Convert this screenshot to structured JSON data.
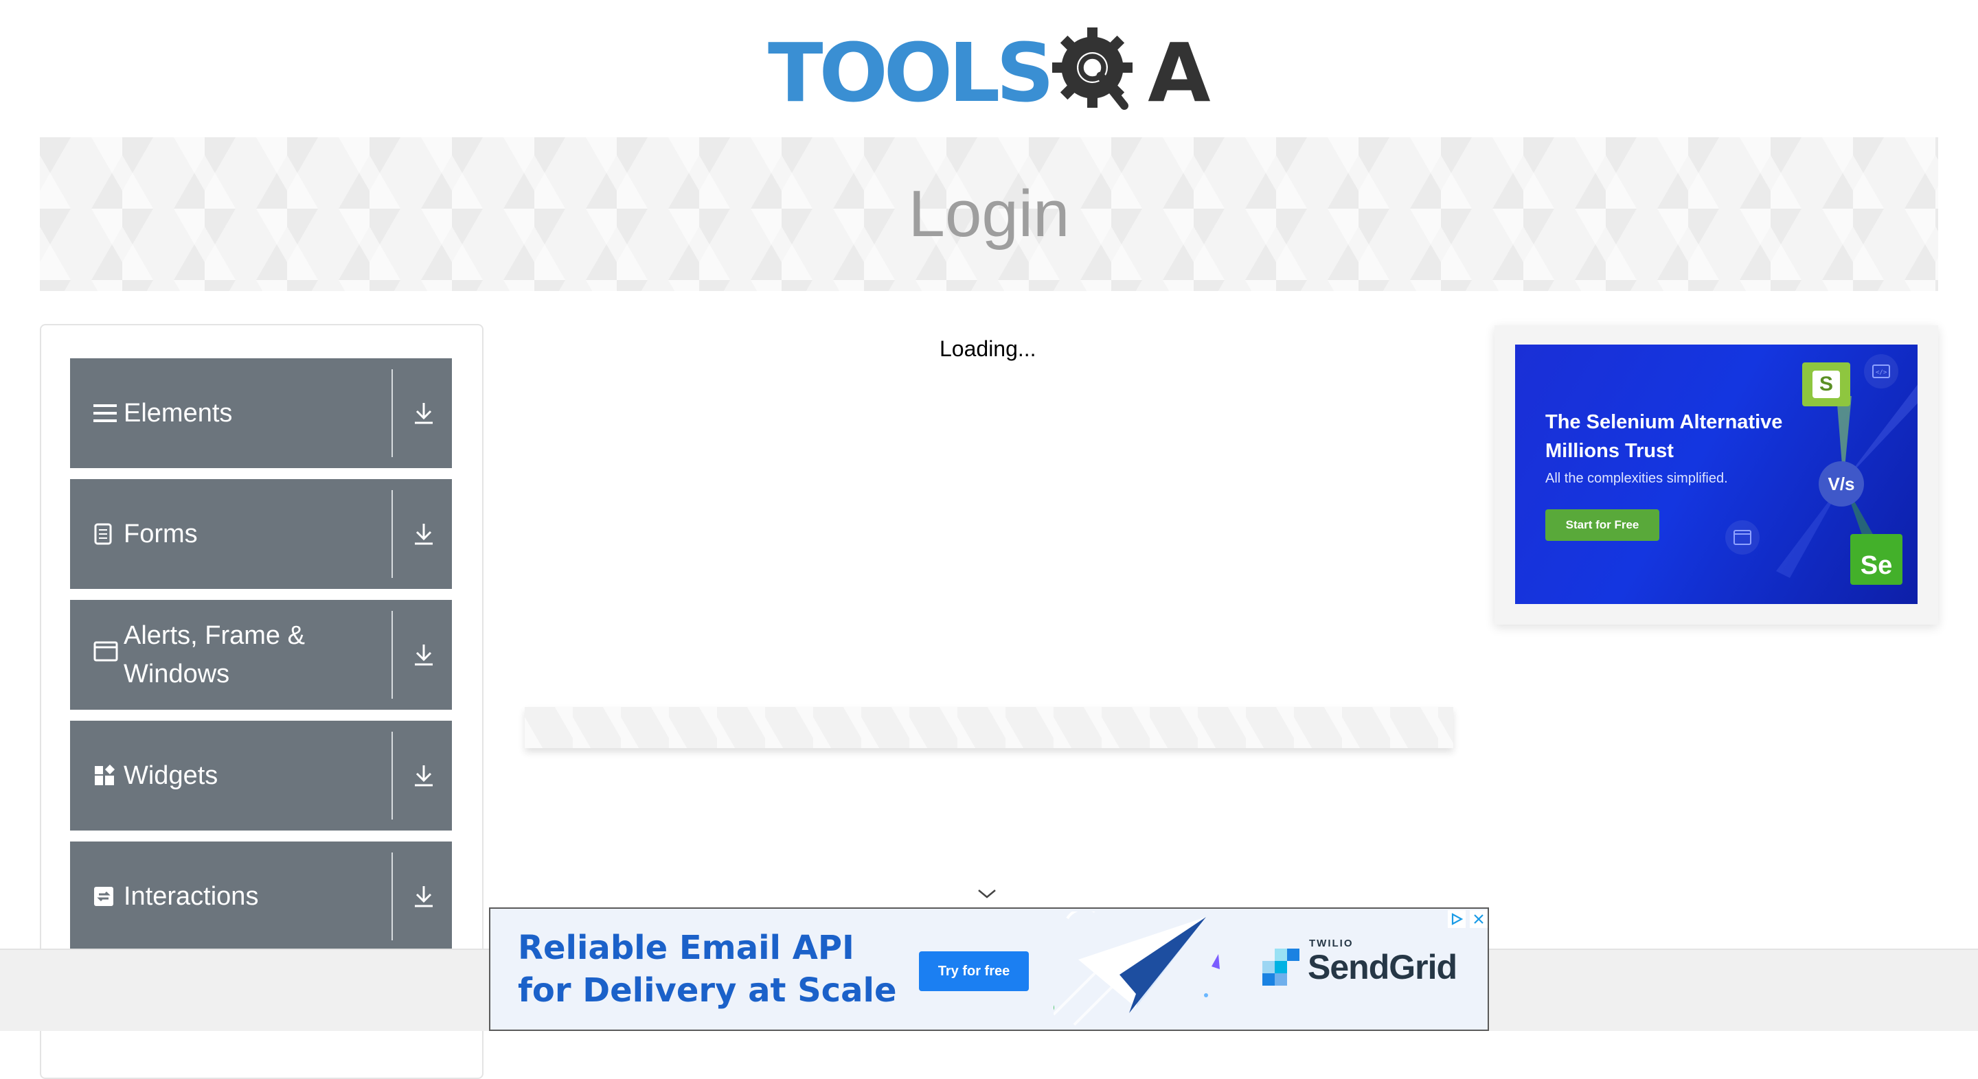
{
  "brand": {
    "logo_text_left": "TOOLS",
    "logo_text_right": "A",
    "logo_color": "#3a8fd3",
    "logo_icon": "gear-magnifier-icon"
  },
  "banner": {
    "title": "Login"
  },
  "sidebar": {
    "groups": [
      {
        "label": "Elements",
        "icon": "hamburger-icon"
      },
      {
        "label": "Forms",
        "icon": "document-icon"
      },
      {
        "label": "Alerts, Frame & Windows",
        "icon": "window-icon"
      },
      {
        "label": "Widgets",
        "icon": "widgets-icon"
      },
      {
        "label": "Interactions",
        "icon": "interactions-icon"
      }
    ],
    "expand_icon": "download-arrow-icon",
    "group_color": "#6c757d"
  },
  "main": {
    "status_text": "Loading..."
  },
  "side_ad": {
    "headline": "The Selenium Alternative\nMillions Trust",
    "subtext": "All the complexities simplified.",
    "cta": "Start for Free",
    "badge_s": "S",
    "badge_vs": "V/s",
    "badge_se": "Se"
  },
  "bottom_ad": {
    "headline": "Reliable Email API\nfor Delivery at Scale",
    "cta": "Try for free",
    "sponsor_top": "TWILIO",
    "sponsor_name": "SendGrid",
    "accent": "#1b61c9"
  }
}
